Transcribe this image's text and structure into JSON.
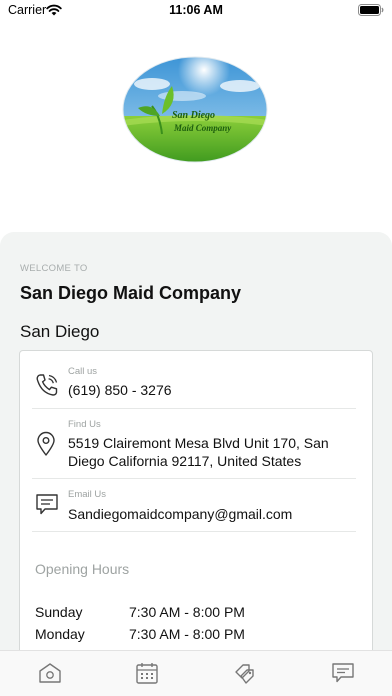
{
  "status_bar": {
    "carrier": "Carrier",
    "time": "11:06 AM"
  },
  "logo": {
    "line1": "San Diego",
    "line2": "Maid Company"
  },
  "header": {
    "welcome": "WELCOME TO",
    "company_name": "San Diego Maid Company",
    "city": "San Diego"
  },
  "contact": {
    "call": {
      "label": "Call us",
      "value": "(619) 850 - 3276",
      "icon": "phone-icon"
    },
    "address": {
      "label": "Find Us",
      "value": "5519 Clairemont Mesa Blvd Unit 170, San Diego California 92117, United States",
      "icon": "map-pin-icon"
    },
    "email": {
      "label": "Email Us",
      "value": "Sandiegomaidcompany@gmail.com",
      "icon": "message-icon"
    }
  },
  "hours": {
    "title": "Opening Hours",
    "rows": [
      {
        "day": "Sunday",
        "time": "7:30 AM - 8:00 PM"
      },
      {
        "day": "Monday",
        "time": "7:30 AM - 8:00 PM"
      }
    ]
  },
  "tabbar": {
    "tabs": [
      {
        "icon": "home-icon"
      },
      {
        "icon": "calendar-icon"
      },
      {
        "icon": "tags-icon"
      },
      {
        "icon": "chat-icon"
      }
    ]
  }
}
